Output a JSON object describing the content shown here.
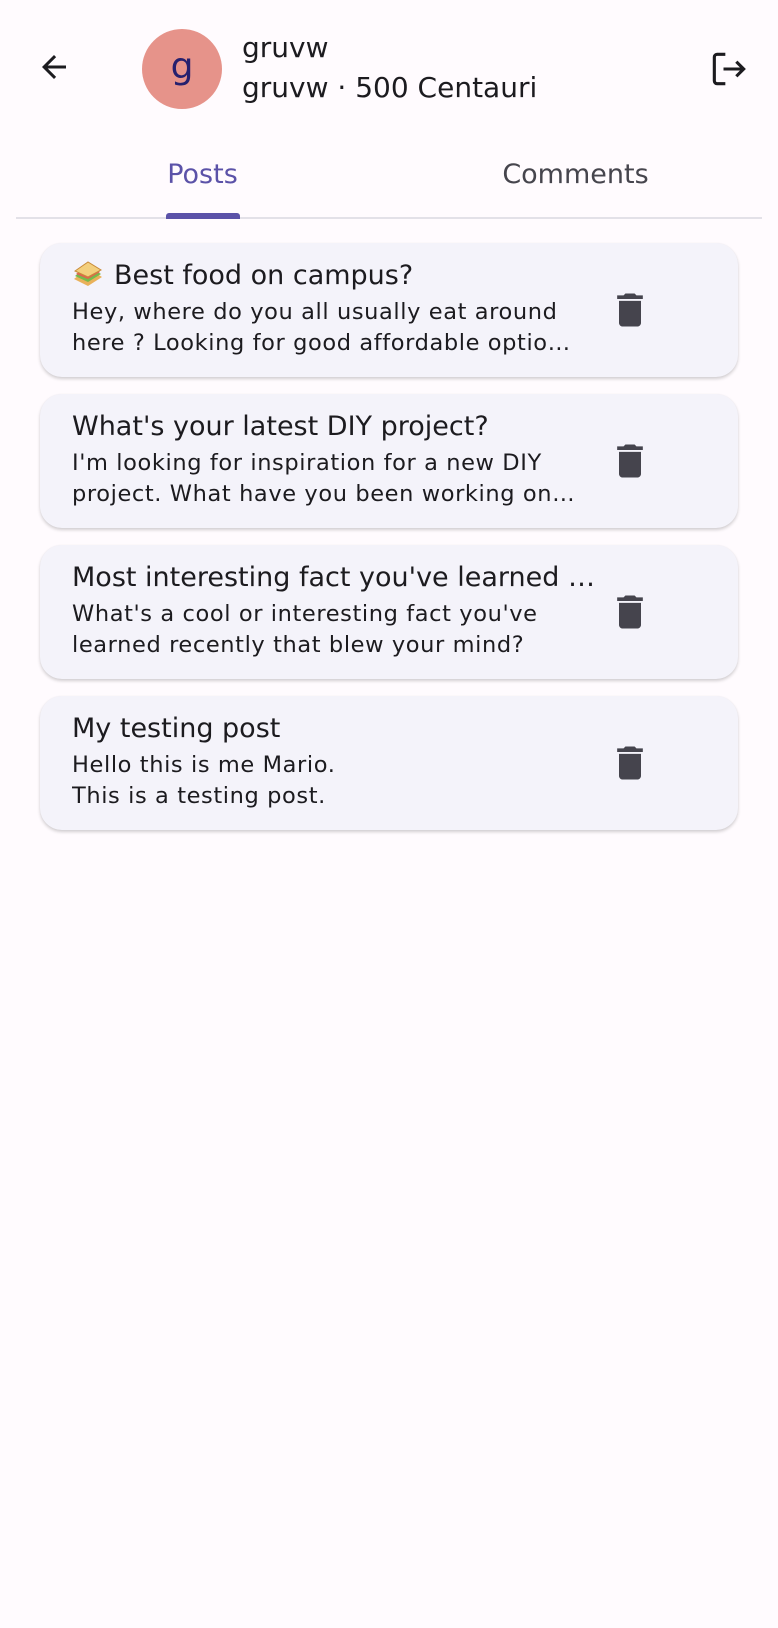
{
  "header": {
    "avatar_letter": "g",
    "username": "gruvw",
    "subtitle": "gruvw · 500 Centauri",
    "back_icon": "arrow-back-icon",
    "logout_icon": "logout-icon"
  },
  "tabs": [
    {
      "label": "Posts",
      "selected": true
    },
    {
      "label": "Comments",
      "selected": false
    }
  ],
  "posts": [
    {
      "emoji": "🥪",
      "title": "Best food on campus?",
      "body": "Hey, where do you all usually eat around here ? Looking for good affordable options and hidden gems."
    },
    {
      "emoji": "",
      "title": "What's your latest DIY project?",
      "body": "I'm looking for inspiration for a new DIY project. What have you been working on lately?"
    },
    {
      "emoji": "",
      "title": "Most interesting fact you've learned recently?",
      "body": "What's a cool or interesting fact you've learned recently that blew your mind?"
    },
    {
      "emoji": "",
      "title": "My testing post",
      "body": "Hello this is me Mario.\nThis is a testing post."
    }
  ],
  "colors": {
    "accent": "#5b52a8",
    "avatar_bg": "#e6938a",
    "card_bg": "#f4f3fa",
    "icon": "#45444d"
  }
}
